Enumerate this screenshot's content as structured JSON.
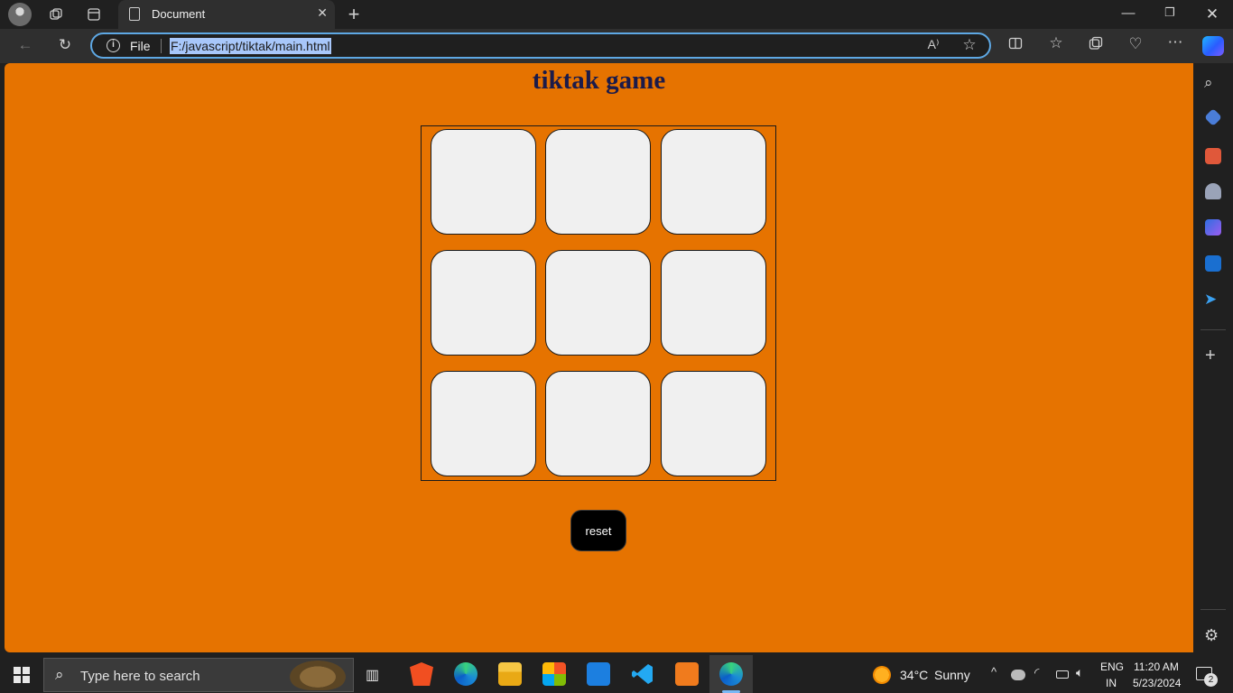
{
  "browser": {
    "tab_title": "Document",
    "address_scheme": "File",
    "address_url": "F:/javascript/tiktak/main.html"
  },
  "page": {
    "title": "tiktak game",
    "reset_label": "reset",
    "cells": [
      "",
      "",
      "",
      "",
      "",
      "",
      "",
      "",
      ""
    ]
  },
  "taskbar": {
    "search_placeholder": "Type here to search",
    "weather_temp": "34°C",
    "weather_desc": "Sunny",
    "lang_top": "ENG",
    "lang_bottom": "IN",
    "time": "11:20 AM",
    "date": "5/23/2024",
    "notification_count": "2"
  },
  "colors": {
    "page_bg": "#e67300",
    "cell_bg": "#f0f0f0",
    "title_color": "#1b1b4a",
    "reset_bg": "#000000"
  }
}
